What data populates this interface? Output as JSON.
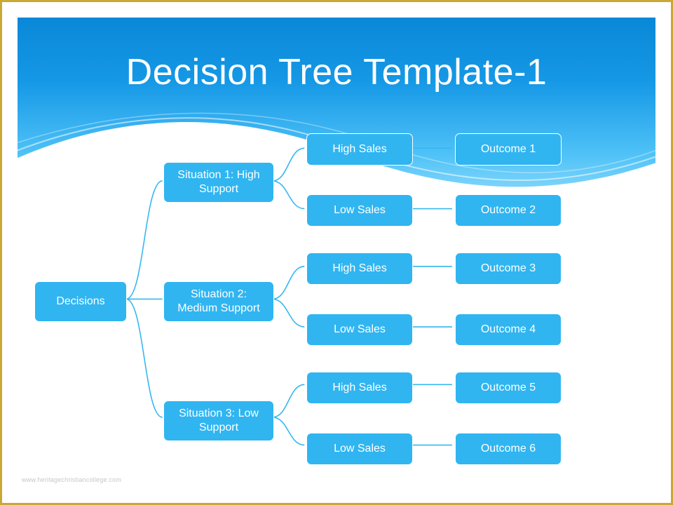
{
  "title": "Decision Tree Template-1",
  "watermark": "www.heritagechristiancollege.com",
  "tree": {
    "root": "Decisions",
    "situations": [
      {
        "label": "Situation 1: High Support",
        "branches": [
          {
            "sales": "High Sales",
            "outcome": "Outcome 1"
          },
          {
            "sales": "Low Sales",
            "outcome": "Outcome 2"
          }
        ]
      },
      {
        "label": "Situation 2: Medium Support",
        "branches": [
          {
            "sales": "High Sales",
            "outcome": "Outcome 3"
          },
          {
            "sales": "Low Sales",
            "outcome": "Outcome 4"
          }
        ]
      },
      {
        "label": "Situation 3: Low Support",
        "branches": [
          {
            "sales": "High Sales",
            "outcome": "Outcome 5"
          },
          {
            "sales": "Low Sales",
            "outcome": "Outcome 6"
          }
        ]
      }
    ]
  },
  "colors": {
    "node": "#30b5f1",
    "sky_top": "#0a88d8",
    "sky_bottom": "#8ddafc",
    "frame": "#c9a934"
  }
}
